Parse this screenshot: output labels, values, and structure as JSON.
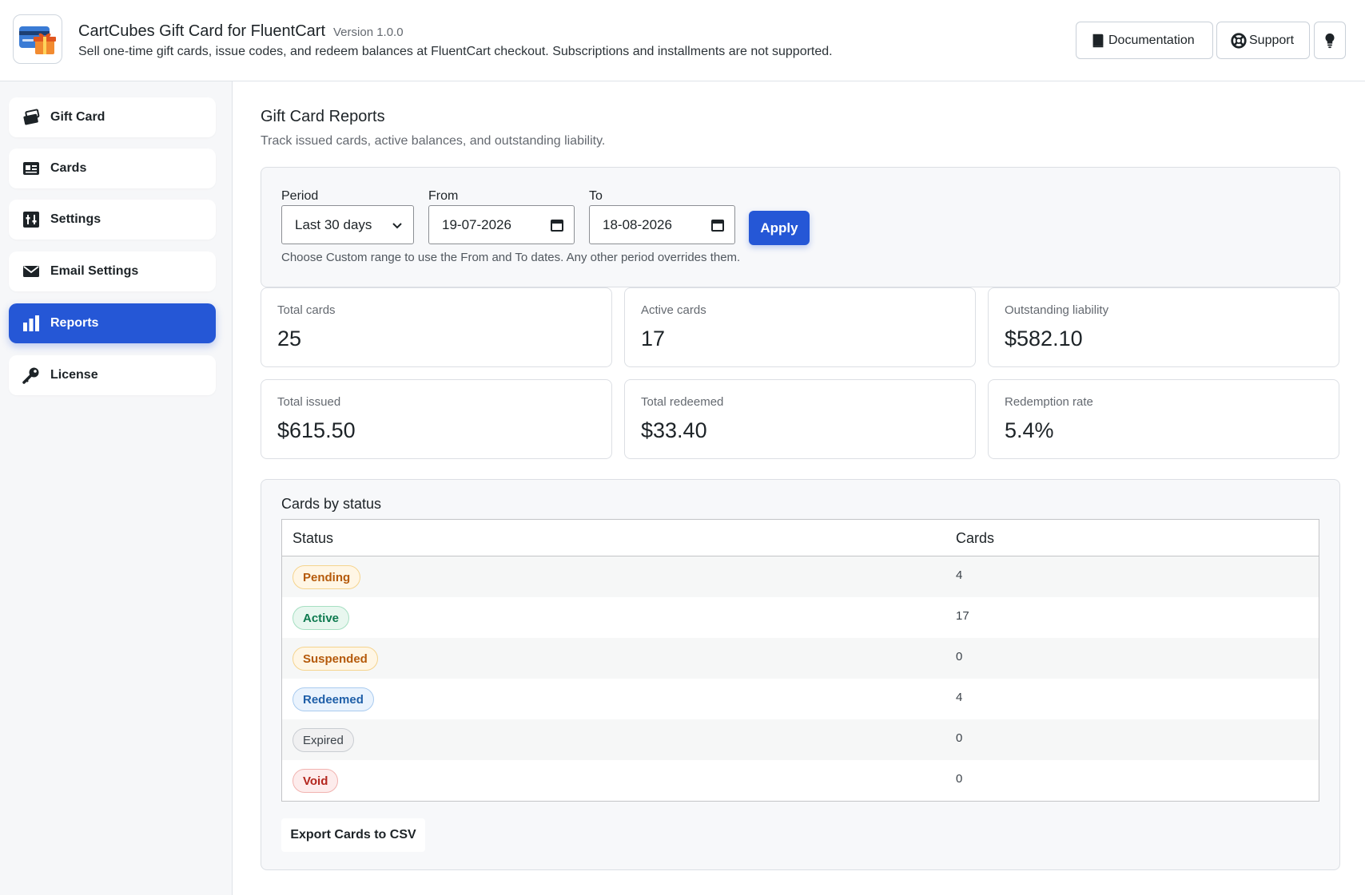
{
  "header": {
    "title": "CartCubes Gift Card for FluentCart",
    "version": "Version 1.0.0",
    "description": "Sell one-time gift cards, issue codes, and redeem balances at FluentCart checkout. Subscriptions and installments are not supported.",
    "documentation_label": "Documentation",
    "support_label": "Support"
  },
  "sidebar": {
    "items": [
      {
        "label": "Gift Card",
        "icon": "gift-cards-icon"
      },
      {
        "label": "Cards",
        "icon": "id-card-icon"
      },
      {
        "label": "Settings",
        "icon": "sliders-icon"
      },
      {
        "label": "Email Settings",
        "icon": "envelope-icon"
      },
      {
        "label": "Reports",
        "icon": "bar-chart-icon",
        "active": true
      },
      {
        "label": "License",
        "icon": "key-icon"
      }
    ]
  },
  "main": {
    "title": "Gift Card Reports",
    "subtitle": "Track issued cards, active balances, and outstanding liability."
  },
  "filters": {
    "period_label": "Period",
    "period_value": "Last 30 days",
    "from_label": "From",
    "from_value": "19-07-2026",
    "to_label": "To",
    "to_value": "18-08-2026",
    "apply_label": "Apply",
    "help": "Choose Custom range to use the From and To dates. Any other period overrides them."
  },
  "stats": [
    {
      "label": "Total cards",
      "value": "25"
    },
    {
      "label": "Active cards",
      "value": "17"
    },
    {
      "label": "Outstanding liability",
      "value": "$582.10"
    },
    {
      "label": "Total issued",
      "value": "$615.50"
    },
    {
      "label": "Total redeemed",
      "value": "$33.40"
    },
    {
      "label": "Redemption rate",
      "value": "5.4%"
    }
  ],
  "status_table": {
    "heading": "Cards by status",
    "columns": [
      "Status",
      "Cards"
    ],
    "rows": [
      {
        "status": "Pending",
        "count": "4"
      },
      {
        "status": "Active",
        "count": "17"
      },
      {
        "status": "Suspended",
        "count": "0"
      },
      {
        "status": "Redeemed",
        "count": "4"
      },
      {
        "status": "Expired",
        "count": "0"
      },
      {
        "status": "Void",
        "count": "0"
      }
    ]
  },
  "export_label": "Export Cards to CSV",
  "colors": {
    "accent": "#2557d6",
    "pending": "#b55a0b",
    "active": "#0e7a4f",
    "suspended": "#b55a0b",
    "redeemed": "#1f5fa8",
    "expired": "#3c434a",
    "void": "#b3261e"
  }
}
